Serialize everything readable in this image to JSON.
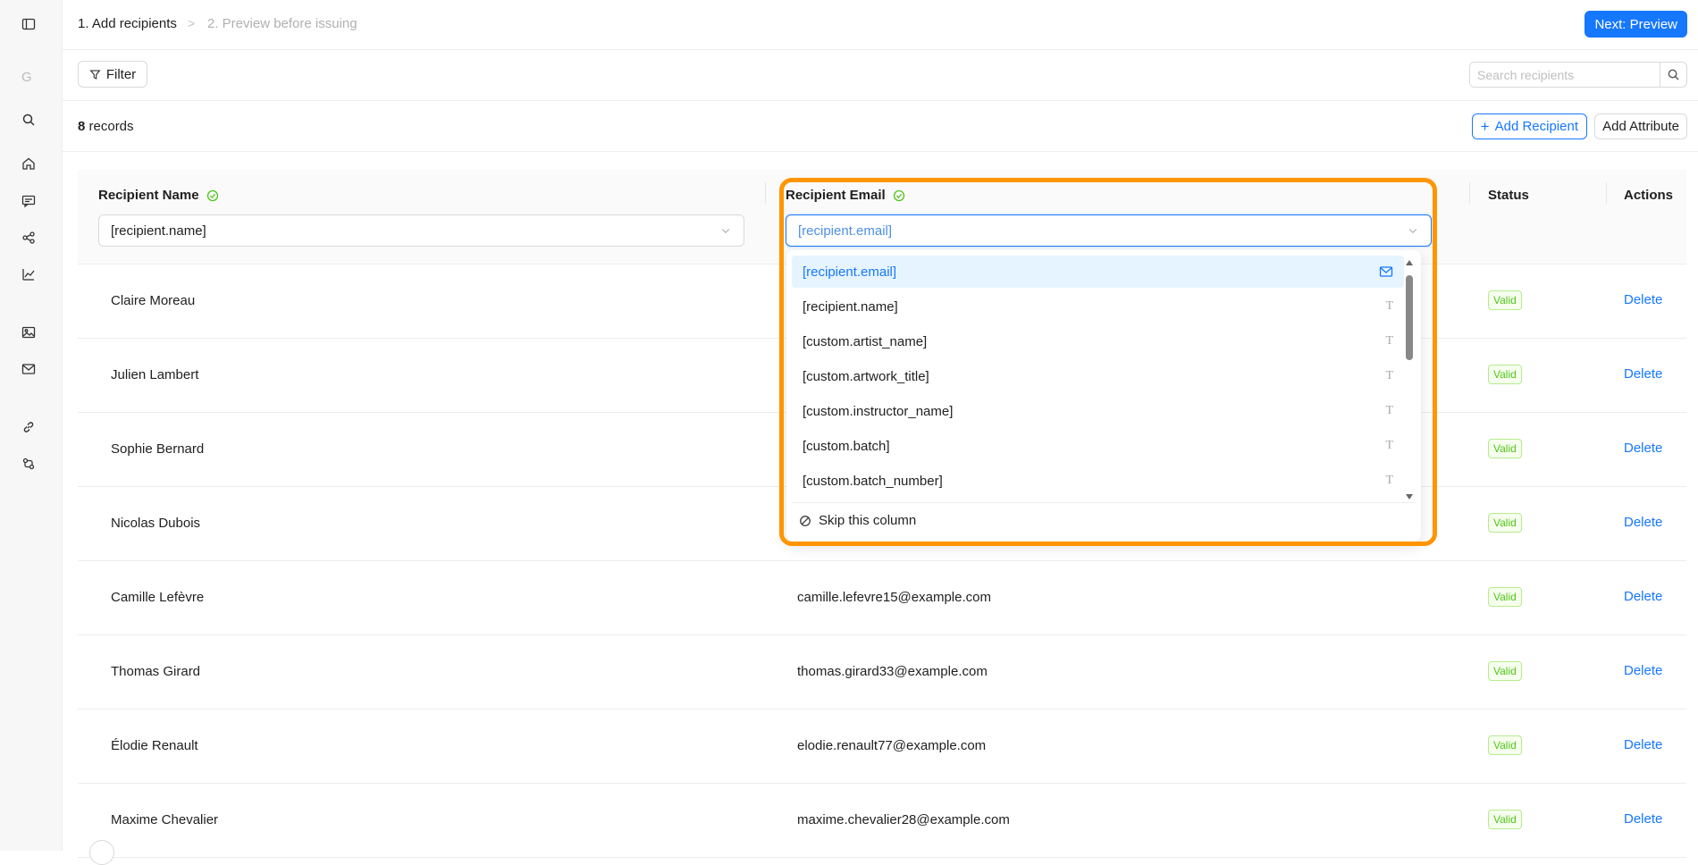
{
  "sidebar": {
    "letter": "G",
    "icons": [
      "sidebar-toggle-icon",
      "search-icon",
      "home-icon",
      "chat-icon",
      "share-icon",
      "chart-icon",
      "image-icon",
      "mail-icon",
      "link-icon",
      "connections-icon"
    ]
  },
  "breadcrumb": {
    "step1": "1. Add recipients",
    "separator": ">",
    "step2": "2. Preview before issuing"
  },
  "header": {
    "next_label": "Next: Preview"
  },
  "toolbar": {
    "filter_label": "Filter",
    "search_placeholder": "Search recipients"
  },
  "records": {
    "count": "8",
    "suffix": " records",
    "add_recipient_label": "Add Recipient",
    "add_attribute_label": "Add Attribute"
  },
  "columns": {
    "name": {
      "title": "Recipient Name",
      "mapping": "[recipient.name]"
    },
    "email": {
      "title": "Recipient Email",
      "mapping": "[recipient.email]"
    },
    "status": {
      "title": "Status"
    },
    "actions": {
      "title": "Actions"
    }
  },
  "dropdown": {
    "options": [
      {
        "label": "[recipient.email]",
        "type": "email-icon",
        "selected": true
      },
      {
        "label": "[recipient.name]",
        "type": "T"
      },
      {
        "label": "[custom.artist_name]",
        "type": "T"
      },
      {
        "label": "[custom.artwork_title]",
        "type": "T"
      },
      {
        "label": "[custom.instructor_name]",
        "type": "T"
      },
      {
        "label": "[custom.batch]",
        "type": "T"
      },
      {
        "label": "[custom.batch_number]",
        "type": "T"
      }
    ],
    "skip_label": "Skip this column"
  },
  "rows": [
    {
      "name": "Claire Moreau",
      "email": "",
      "status": "Valid",
      "action": "Delete"
    },
    {
      "name": "Julien Lambert",
      "email": "",
      "status": "Valid",
      "action": "Delete"
    },
    {
      "name": "Sophie Bernard",
      "email": "",
      "status": "Valid",
      "action": "Delete"
    },
    {
      "name": "Nicolas Dubois",
      "email": "",
      "status": "Valid",
      "action": "Delete"
    },
    {
      "name": "Camille Lefèvre",
      "email": "camille.lefevre15@example.com",
      "status": "Valid",
      "action": "Delete"
    },
    {
      "name": "Thomas Girard",
      "email": "thomas.girard33@example.com",
      "status": "Valid",
      "action": "Delete"
    },
    {
      "name": "Élodie Renault",
      "email": "elodie.renault77@example.com",
      "status": "Valid",
      "action": "Delete"
    },
    {
      "name": "Maxime Chevalier",
      "email": "maxime.chevalier28@example.com",
      "status": "Valid",
      "action": "Delete"
    }
  ],
  "colors": {
    "primary": "#1677ff",
    "highlight": "#ff9500",
    "valid_text": "#52c41a",
    "valid_bg": "#f6ffed"
  }
}
